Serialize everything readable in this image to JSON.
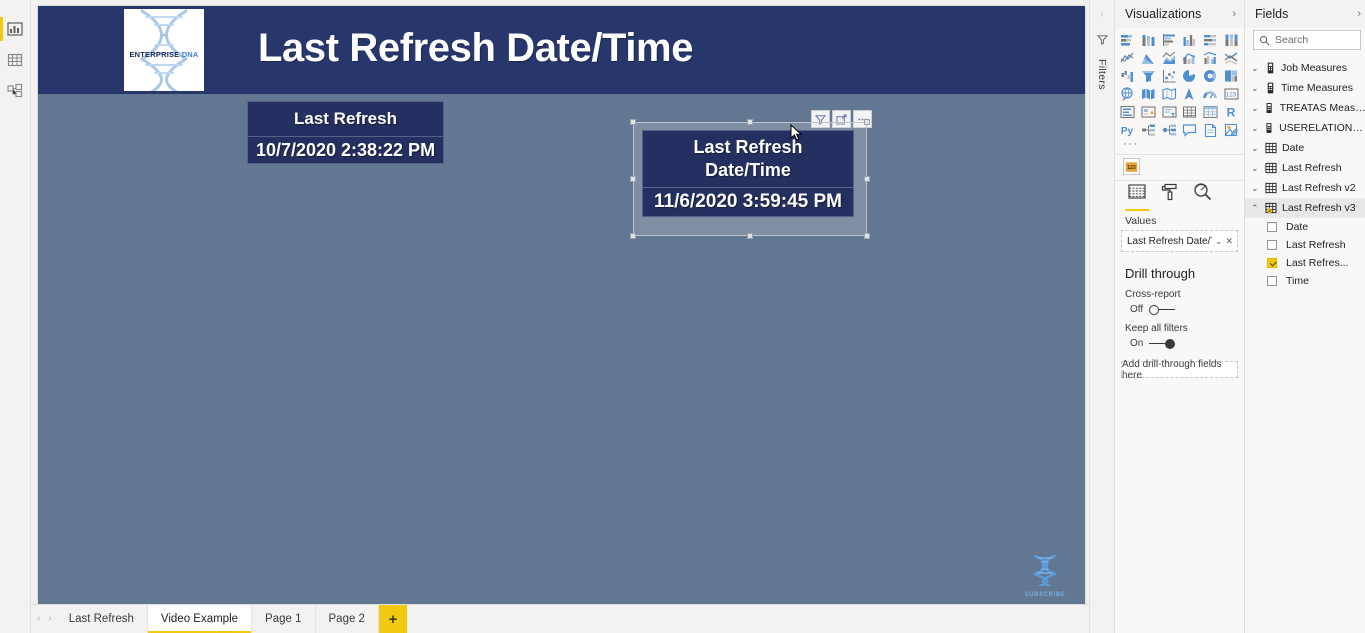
{
  "left_rail": {
    "items": [
      {
        "name": "report-view",
        "icon": "report-icon",
        "active": true
      },
      {
        "name": "data-view",
        "icon": "table-icon",
        "active": false
      },
      {
        "name": "model-view",
        "icon": "model-icon",
        "active": false
      }
    ]
  },
  "report": {
    "banner_title": "Last Refresh Date/Time",
    "logo": {
      "primary": "ENTERPRISE",
      "secondary": "DNA"
    },
    "banner_color": "#27366b",
    "canvas_color": "#627791",
    "card_color": "#24305f",
    "cards": [
      {
        "id": "card-last-refresh",
        "title": "Last Refresh",
        "value": "10/7/2020 2:38:22 PM",
        "selected": false
      },
      {
        "id": "card-last-refresh-datetime",
        "title_line1": "Last Refresh",
        "title_line2": "Date/Time",
        "value": "11/6/2020 3:59:45 PM",
        "selected": true
      }
    ],
    "visual_header_buttons": [
      {
        "name": "filter-icon",
        "label": "Filters"
      },
      {
        "name": "focus-mode-icon",
        "label": "Focus mode"
      },
      {
        "name": "more-options-icon",
        "label": "More options"
      }
    ],
    "watermark": {
      "label": "SUBSCRIBE"
    }
  },
  "tabbar": {
    "nav_prev": "‹",
    "nav_next": "›",
    "tabs": [
      {
        "label": "Last Refresh",
        "active": false
      },
      {
        "label": "Video Example",
        "active": true
      },
      {
        "label": "Page 1",
        "active": false
      },
      {
        "label": "Page 2",
        "active": false
      }
    ],
    "add_label": "+"
  },
  "filters_strip": {
    "collapse": "‹",
    "label": "Filters"
  },
  "visualizations": {
    "title": "Visualizations",
    "expand_chevron": "›",
    "more_label": "···",
    "icons": [
      "stacked-bar-chart-icon",
      "stacked-column-chart-icon",
      "clustered-bar-chart-icon",
      "clustered-column-chart-icon",
      "100-stacked-bar-chart-icon",
      "100-stacked-column-chart-icon",
      "line-chart-icon",
      "area-chart-icon",
      "stacked-area-chart-icon",
      "line-stacked-column-chart-icon",
      "line-clustered-column-chart-icon",
      "ribbon-chart-icon",
      "waterfall-chart-icon",
      "funnel-icon",
      "scatter-chart-icon",
      "pie-chart-icon",
      "donut-chart-icon",
      "treemap-icon",
      "map-icon",
      "filled-map-icon",
      "shape-map-icon",
      "arcgis-map-icon",
      "gauge-icon",
      "card-icon",
      "multi-row-card-icon",
      "kpi-icon",
      "slicer-icon",
      "table-icon",
      "matrix-icon",
      "r-script-visual-icon",
      "python-visual-icon",
      "decomposition-tree-icon",
      "key-influencers-icon",
      "qa-visual-icon",
      "paginated-report-icon",
      "get-more-visuals-icon"
    ],
    "selected_visual": "card-icon",
    "tabs": [
      {
        "name": "fields-tab",
        "icon": "fields-icon",
        "active": true
      },
      {
        "name": "format-tab",
        "icon": "paint-roller-icon",
        "active": false
      },
      {
        "name": "analytics-tab",
        "icon": "magnifier-icon",
        "active": false
      }
    ],
    "values_label": "Values",
    "values_fields": [
      {
        "label": "Last Refresh Date/Time",
        "dropdown": "⌄",
        "remove": "✕"
      }
    ],
    "drill_through": {
      "title": "Drill through",
      "cross_report_label": "Cross-report",
      "cross_report_state": "Off",
      "keep_all_filters_label": "Keep all filters",
      "keep_all_filters_state": "On",
      "dropzone_label": "Add drill-through fields here"
    }
  },
  "fields": {
    "title": "Fields",
    "expand_chevron": "›",
    "search_placeholder": "Search",
    "tables": [
      {
        "label": "Job Measures",
        "icon": "measure-table-icon",
        "expanded": false,
        "selected": false
      },
      {
        "label": "Time Measures",
        "icon": "measure-table-icon",
        "expanded": false,
        "selected": false
      },
      {
        "label": "TREATAS Measures",
        "icon": "measure-table-icon",
        "expanded": false,
        "selected": false
      },
      {
        "label": "USERELATIONSHI...",
        "icon": "measure-table-icon",
        "expanded": false,
        "selected": false
      },
      {
        "label": "Date",
        "icon": "table-icon",
        "expanded": false,
        "selected": false
      },
      {
        "label": "Last Refresh",
        "icon": "table-icon",
        "expanded": false,
        "selected": false
      },
      {
        "label": "Last Refresh v2",
        "icon": "table-icon",
        "expanded": false,
        "selected": false
      },
      {
        "label": "Last Refresh v3",
        "icon": "table-icon",
        "expanded": true,
        "selected": true
      }
    ],
    "expanded_children": [
      {
        "label": "Date",
        "checked": false
      },
      {
        "label": "Last Refresh",
        "checked": false
      },
      {
        "label": "Last Refres...",
        "checked": true
      },
      {
        "label": "Time",
        "checked": false
      }
    ]
  }
}
